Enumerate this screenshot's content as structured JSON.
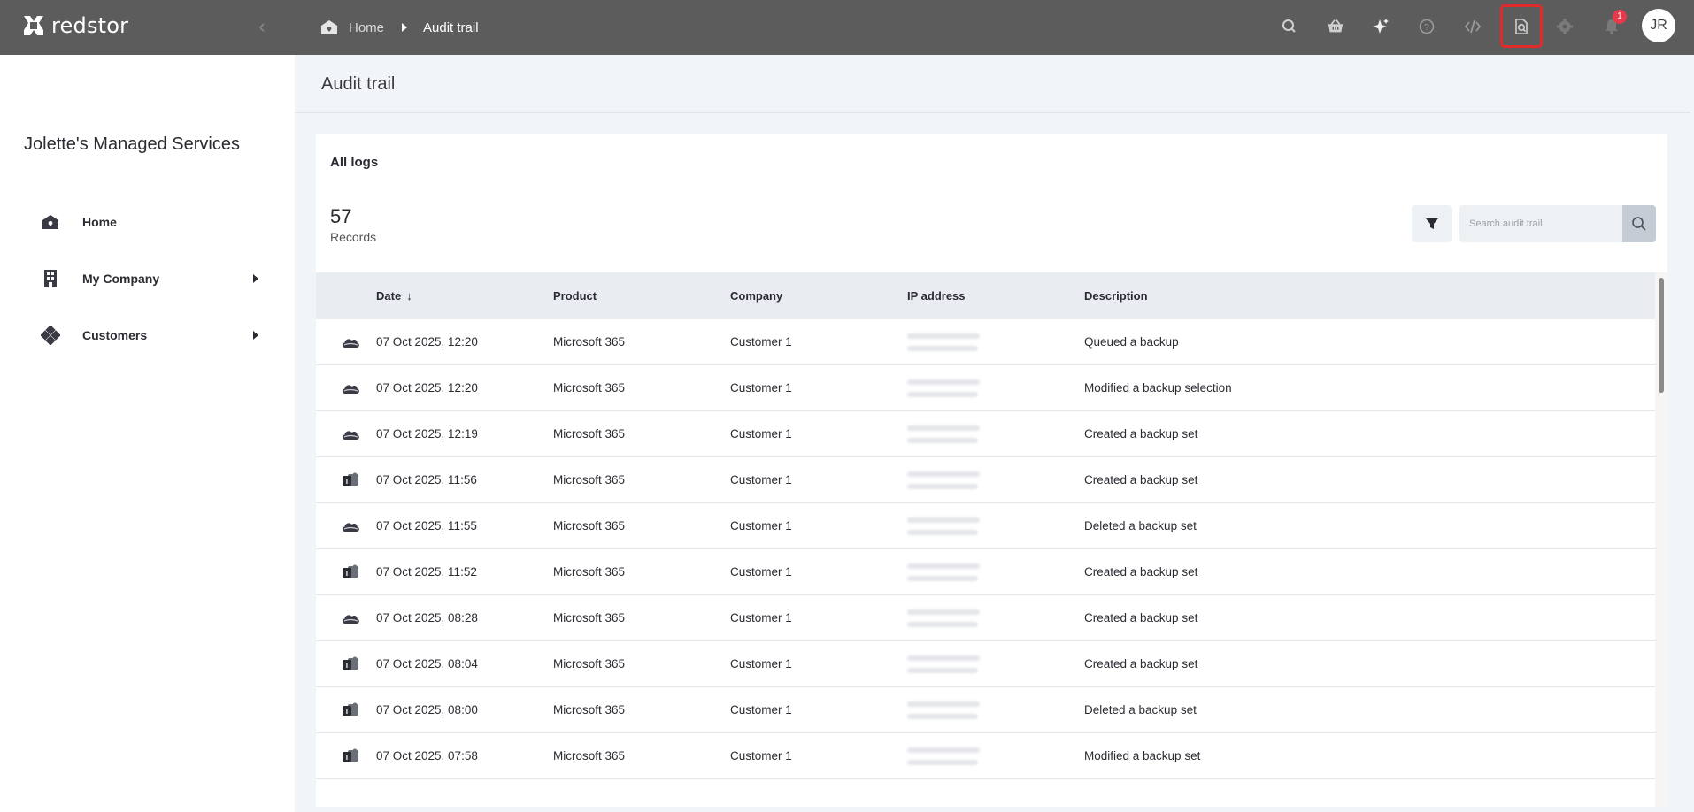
{
  "app": {
    "name": "redstor"
  },
  "breadcrumb": {
    "home": "Home",
    "current": "Audit trail"
  },
  "topbar": {
    "icons": [
      "search-icon",
      "basket-icon",
      "sparkle-icon",
      "help-icon",
      "code-icon",
      "audit-search-icon",
      "gear-icon",
      "bell-icon"
    ],
    "notification_count": "1",
    "avatar_initials": "JR",
    "highlighted_icon": "audit-search-icon",
    "annotation_color": "#e02b2b"
  },
  "sidebar": {
    "org_name": "Jolette's Managed Services",
    "items": [
      {
        "label": "Home",
        "icon": "home-icon"
      },
      {
        "label": "My Company",
        "icon": "building-icon"
      },
      {
        "label": "Customers",
        "icon": "customers-icon"
      }
    ]
  },
  "page": {
    "title": "Audit trail"
  },
  "card": {
    "title": "All logs",
    "records_count": "57",
    "records_label": "Records",
    "search_placeholder": "Search audit trail"
  },
  "table": {
    "columns": {
      "date": "Date",
      "product": "Product",
      "company": "Company",
      "ip": "IP address",
      "description": "Description"
    },
    "rows": [
      {
        "icon": "cloud-icon",
        "date": "07 Oct 2025, 12:20",
        "product": "Microsoft 365",
        "company": "Customer 1",
        "description": "Queued a backup"
      },
      {
        "icon": "cloud-icon",
        "date": "07 Oct 2025, 12:20",
        "product": "Microsoft 365",
        "company": "Customer 1",
        "description": "Modified a backup selection"
      },
      {
        "icon": "cloud-icon",
        "date": "07 Oct 2025, 12:19",
        "product": "Microsoft 365",
        "company": "Customer 1",
        "description": "Created a backup set"
      },
      {
        "icon": "teams-icon",
        "date": "07 Oct 2025, 11:56",
        "product": "Microsoft 365",
        "company": "Customer 1",
        "description": "Created a backup set"
      },
      {
        "icon": "cloud-icon",
        "date": "07 Oct 2025, 11:55",
        "product": "Microsoft 365",
        "company": "Customer 1",
        "description": "Deleted a backup set"
      },
      {
        "icon": "teams-icon",
        "date": "07 Oct 2025, 11:52",
        "product": "Microsoft 365",
        "company": "Customer 1",
        "description": "Created a backup set"
      },
      {
        "icon": "cloud-icon",
        "date": "07 Oct 2025, 08:28",
        "product": "Microsoft 365",
        "company": "Customer 1",
        "description": "Created a backup set"
      },
      {
        "icon": "teams-icon",
        "date": "07 Oct 2025, 08:04",
        "product": "Microsoft 365",
        "company": "Customer 1",
        "description": "Created a backup set"
      },
      {
        "icon": "teams-icon",
        "date": "07 Oct 2025, 08:00",
        "product": "Microsoft 365",
        "company": "Customer 1",
        "description": "Deleted a backup set"
      },
      {
        "icon": "teams-icon",
        "date": "07 Oct 2025, 07:58",
        "product": "Microsoft 365",
        "company": "Customer 1",
        "description": "Modified a backup set"
      }
    ]
  }
}
